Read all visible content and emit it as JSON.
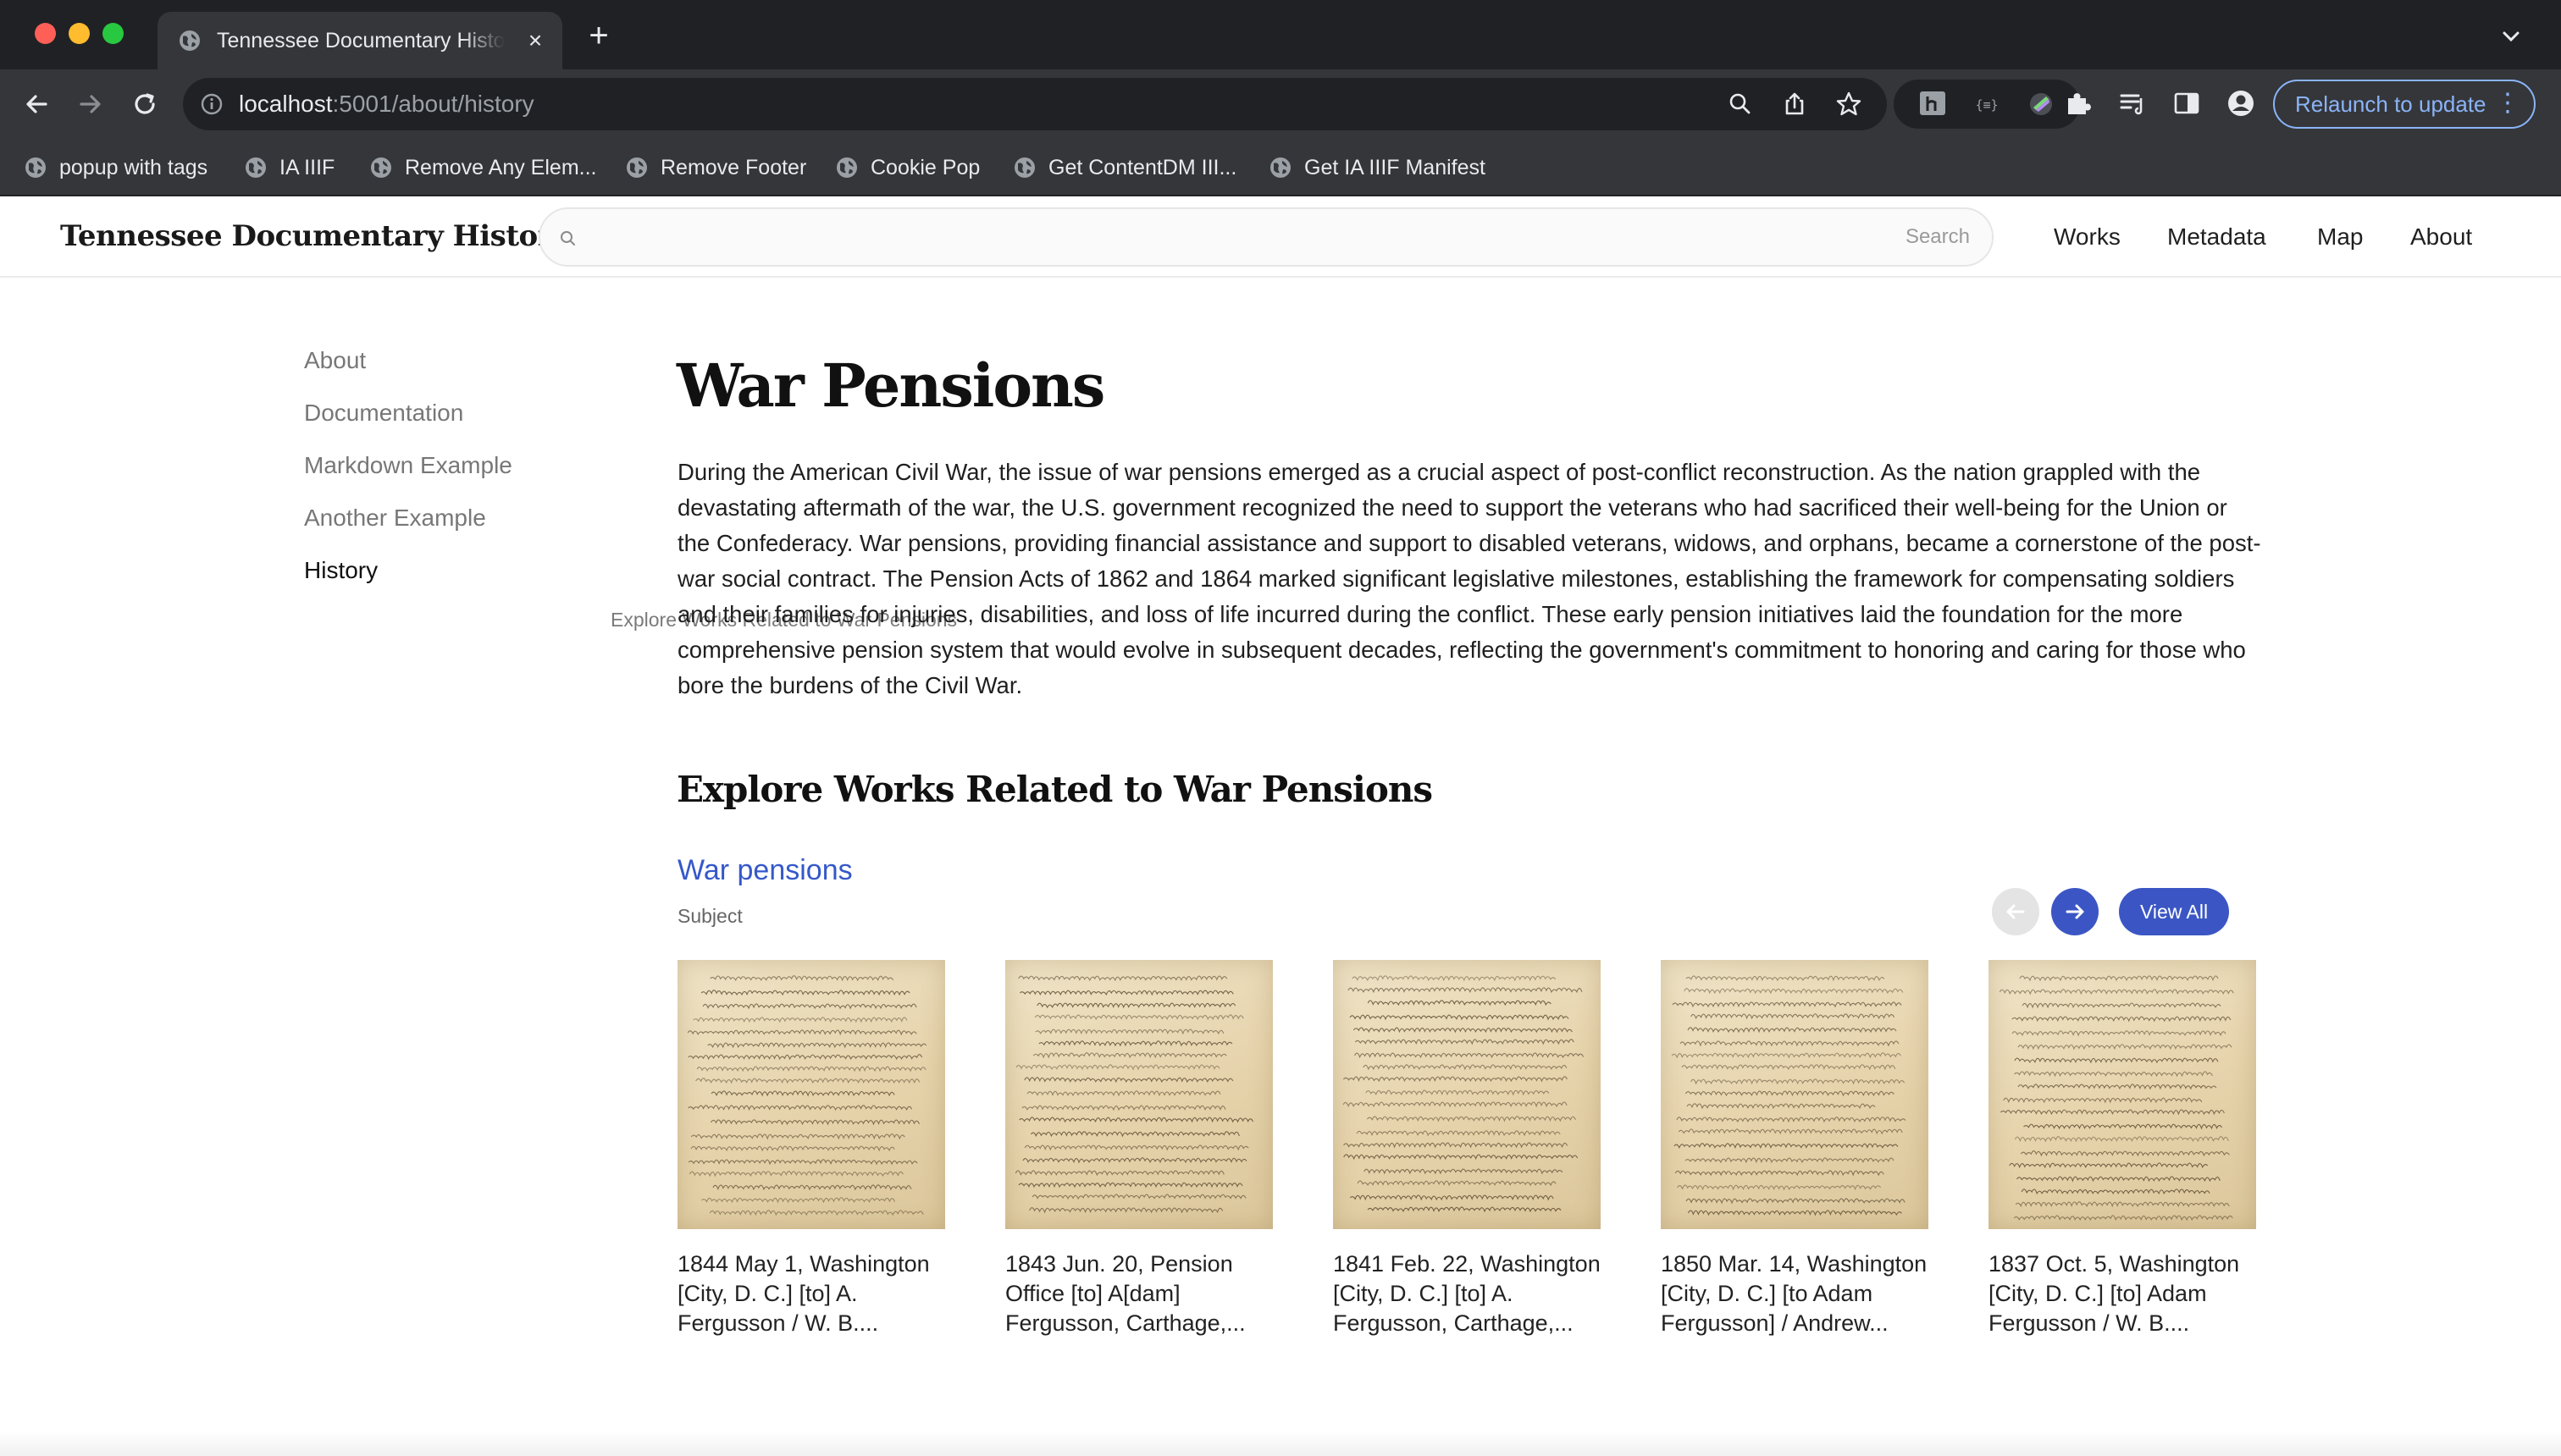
{
  "browser": {
    "tab_title": "Tennessee Documentary History",
    "url_host": "localhost",
    "url_path": ":5001/about/history",
    "relaunch_label": "Relaunch to update",
    "bookmarks": [
      {
        "label": "popup with tags"
      },
      {
        "label": "IA IIIF"
      },
      {
        "label": "Remove Any Elem..."
      },
      {
        "label": "Remove Footer"
      },
      {
        "label": "Cookie Pop"
      },
      {
        "label": "Get ContentDM III..."
      },
      {
        "label": "Get IA IIIF Manifest"
      }
    ]
  },
  "header": {
    "site_title": "Tennessee Documentary History",
    "search_button": "Search",
    "nav": [
      "Works",
      "Metadata",
      "Map",
      "About"
    ]
  },
  "sidebar": {
    "items": [
      "About",
      "Documentation",
      "Markdown Example",
      "Another Example",
      "History"
    ],
    "active": "History",
    "sub_item": "Explore Works Related to War Pensions"
  },
  "main": {
    "title": "War Pensions",
    "intro": "During the American Civil War, the issue of war pensions emerged as a crucial aspect of post-conflict reconstruction. As the nation grappled with the devastating aftermath of the war, the U.S. government recognized the need to support the veterans who had sacrificed their well-being for the Union or the Confederacy. War pensions, providing financial assistance and support to disabled veterans, widows, and orphans, became a cornerstone of the post-war social contract. The Pension Acts of 1862 and 1864 marked significant legislative milestones, establishing the framework for compensating soldiers and their families for injuries, disabilities, and loss of life incurred during the conflict. These early pension initiatives laid the foundation for the more comprehensive pension system that would evolve in subsequent decades, reflecting the government's commitment to honoring and caring for those who bore the burdens of the Civil War.",
    "section_title": "Explore Works Related to War Pensions",
    "subject_link": "War pensions",
    "subject_type": "Subject",
    "view_all": "View All",
    "works": [
      {
        "title": "1844 May 1, Washington [City, D. C.] [to] A. Fergusson / W. B...."
      },
      {
        "title": "1843 Jun. 20, Pension Office [to] A[dam] Fergusson, Carthage,..."
      },
      {
        "title": "1841 Feb. 22, Washington [City, D. C.] [to] A. Fergusson, Carthage,..."
      },
      {
        "title": "1850 Mar. 14, Washington [City, D. C.] [to Adam Fergusson] / Andrew..."
      },
      {
        "title": "1837 Oct. 5, Washington [City, D. C.] [to] Adam Fergusson / W. B...."
      }
    ]
  },
  "colors": {
    "accent": "#3b56c4",
    "link": "#3558c9",
    "chrome_dark": "#202124",
    "chrome_mid": "#35363a"
  },
  "icons": {
    "favicon": "globe-icon",
    "search": "search-icon",
    "prev": "arrow-left-icon",
    "next": "arrow-right-icon"
  }
}
